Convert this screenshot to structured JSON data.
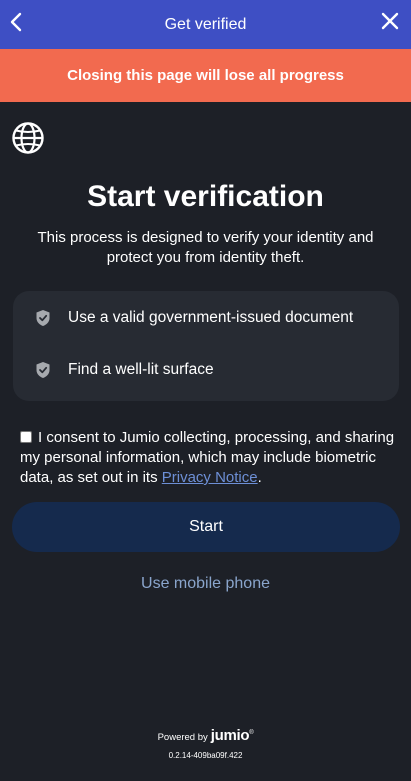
{
  "header": {
    "title": "Get verified",
    "back_icon": "chevron-left-icon",
    "close_icon": "close-icon"
  },
  "warning": {
    "text": "Closing this page will lose all progress"
  },
  "language": {
    "icon": "globe-icon"
  },
  "main": {
    "title": "Start verification",
    "subtitle": "This process is designed to verify your identity and protect you from identity theft."
  },
  "tips": [
    {
      "icon": "shield-check-icon",
      "text": "Use a valid government-issued document"
    },
    {
      "icon": "shield-check-icon",
      "text": "Find a well-lit surface"
    }
  ],
  "consent": {
    "checked": false,
    "text_before": "I consent to Jumio collecting, processing, and sharing my personal information, which may include biometric data, as set out in its ",
    "link_text": "Privacy Notice",
    "text_after": "."
  },
  "actions": {
    "start_label": "Start",
    "mobile_label": "Use mobile phone"
  },
  "footer": {
    "powered_by": "Powered by",
    "brand": "jumio",
    "brand_mark": "®",
    "version": "0.2.14-409ba09f.422"
  },
  "colors": {
    "header_bg": "#3e4fc4",
    "warning_bg": "#f26a4f",
    "page_bg": "#1d2027",
    "card_bg": "#272b33",
    "button_bg": "#152a4d",
    "link": "#6d8fd6"
  }
}
